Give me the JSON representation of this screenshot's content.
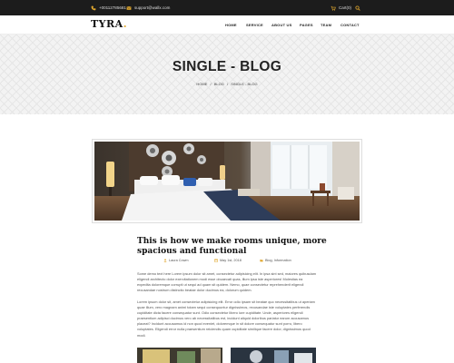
{
  "topbar": {
    "phone": "+00112785681",
    "email": "support@wallx.com",
    "cart_label": "Cart(0)"
  },
  "header": {
    "logo": "TYRA",
    "logo_dot": ".",
    "nav": [
      "HOME",
      "SERVICE",
      "ABOUT US",
      "PAGES",
      "TEAM",
      "CONTACT"
    ]
  },
  "hero": {
    "title": "SINGLE - BLOG",
    "breadcrumb": [
      "HOME",
      "/",
      "BLOG",
      "/",
      "SINGLE - BLOG"
    ]
  },
  "article": {
    "title": "This is how we make rooms unique, more spacious and functional",
    "meta": {
      "author": "Laura Cowm",
      "date": "May 1st, 2018",
      "category": "Blog, Information"
    },
    "paragraph_1": "Some demo text here Lorem ipsum dolor sit amet, consectetur adipisicing elit. In ipsa sint sed, maiores quibusdam eligendi architecto dolor exercitationem modi esse obcaecati quas, illum ipsa iste asperiores! Molestias ea expedita doloremque corrupti ut sequi ad quam sit quidem. Nemo, quae consectetur reprehenderit eligendi recusandae nostrum distinctio beatae dolor ducimus ea, dolorum quidem.",
    "paragraph_2": "Lorem ipsum dolor sit, amet consectetur adipisicing elit. Error odio ipsam sit beatae quo necessitatibus ut aperiam quae illum, vero magnam animi totam sequi consequuntur dignissimos, recusandae iste voluptates perferendis cupiditate dicta facere consequatur sunt. Odio consectetur libero iure cupiditate. Unde, asperiores eligendi praesentium adipisci ducimus vero ab necessitatibus est, incidunt aliquid doloribus pariatur earum accusamus placeat? Incidunt accusamus id non quod eveniet, doloremque in sit dolore consequatur sunt porro, libero voluptates. Eligendi error nulla praesentium reiciendis quam cupiditate similique facere dolor, dignissimos quod modi."
  },
  "colors": {
    "topbar_bg": "#1c1c1c",
    "accent": "#e0a72e",
    "hero_bg": "#f3f3f3"
  },
  "icons": [
    "phone-icon",
    "mail-icon",
    "cart-icon",
    "search-icon",
    "user-icon",
    "calendar-icon",
    "folder-icon"
  ]
}
